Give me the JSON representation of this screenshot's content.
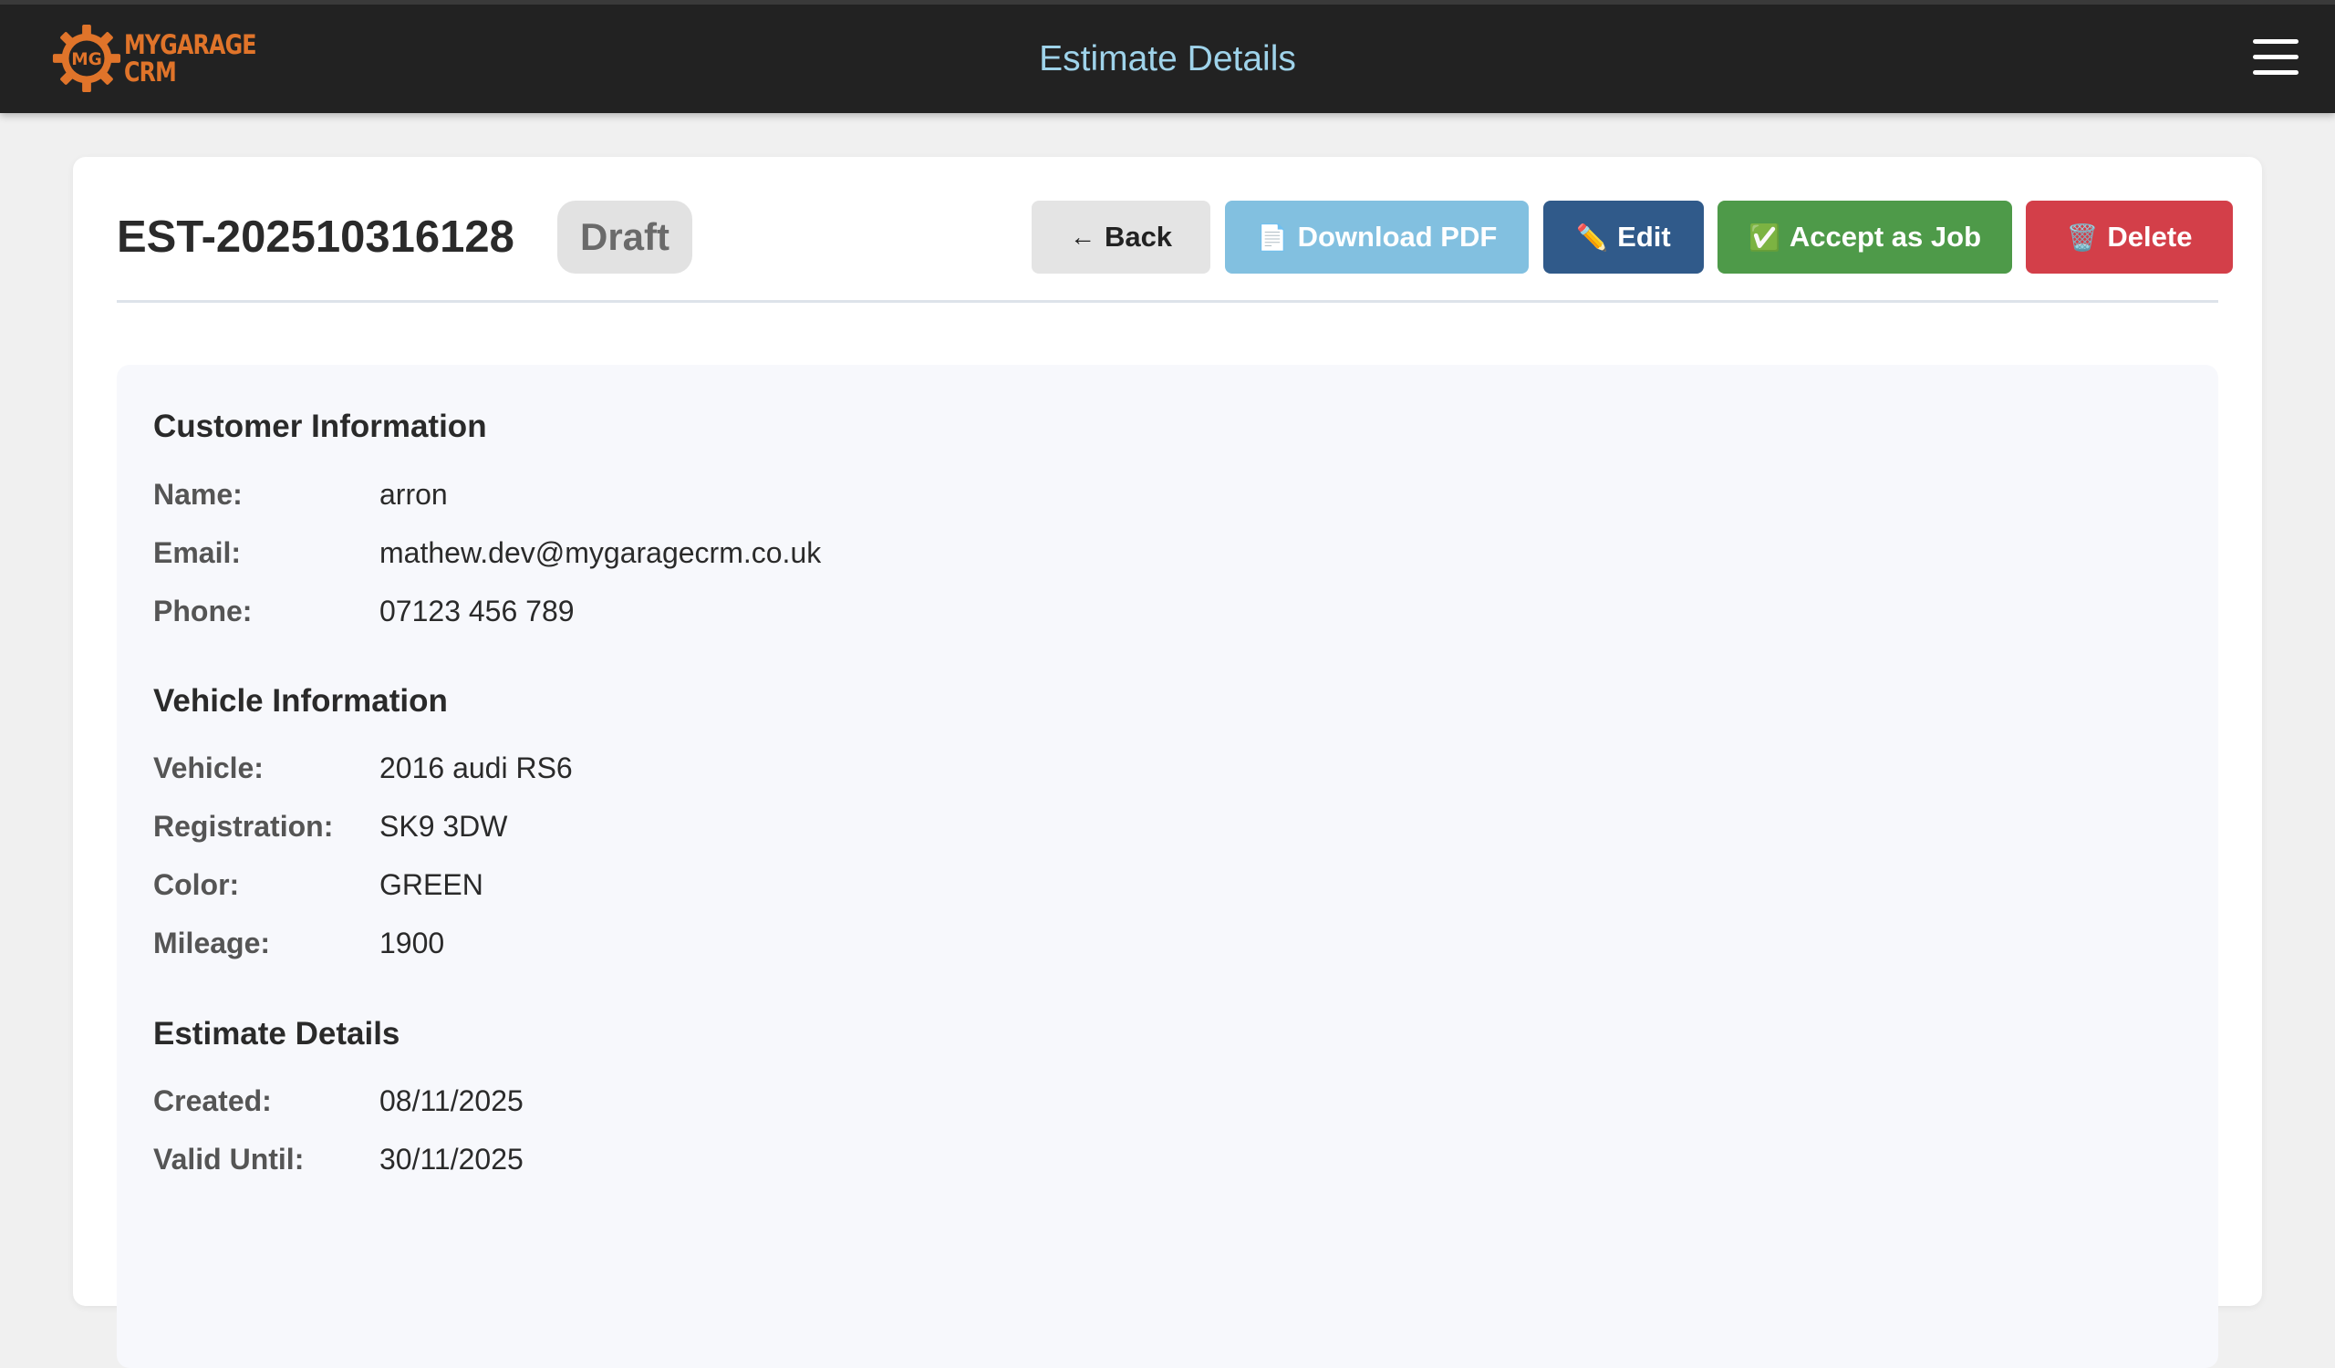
{
  "header": {
    "logo_line1": "MYGARAGE",
    "logo_line2": "CRM",
    "logo_badge": "MG",
    "title": "Estimate Details",
    "menu_icon": "hamburger-menu-icon"
  },
  "estimate": {
    "number": "EST-202510316128",
    "status": "Draft"
  },
  "actions": {
    "back_icon": "←",
    "back_label": "Back",
    "pdf_icon": "📄",
    "pdf_label": "Download PDF",
    "edit_icon": "✏️",
    "edit_label": "Edit",
    "accept_icon": "✅",
    "accept_label": "Accept as Job",
    "delete_icon": "🗑️",
    "delete_label": "Delete"
  },
  "customer": {
    "title": "Customer Information",
    "name_label": "Name:",
    "name": "arron",
    "email_label": "Email:",
    "email": "mathew.dev@mygaragecrm.co.uk",
    "phone_label": "Phone:",
    "phone": "07123 456 789"
  },
  "vehicle": {
    "title": "Vehicle Information",
    "vehicle_label": "Vehicle:",
    "vehicle": "2016 audi RS6",
    "registration_label": "Registration:",
    "registration": "SK9 3DW",
    "color_label": "Color:",
    "color": "GREEN",
    "mileage_label": "Mileage:",
    "mileage": "1900"
  },
  "details": {
    "title": "Estimate Details",
    "created_label": "Created:",
    "created": "08/11/2025",
    "valid_label": "Valid Until:",
    "valid_until": "30/11/2025"
  },
  "colors": {
    "topbar": "#222222",
    "brand": "#e0742a",
    "title": "#9fd3ea",
    "back": "#e4e4e4",
    "pdf": "#82c0e0",
    "edit": "#305a8a",
    "accept": "#4e9a49",
    "delete": "#d33f49"
  }
}
